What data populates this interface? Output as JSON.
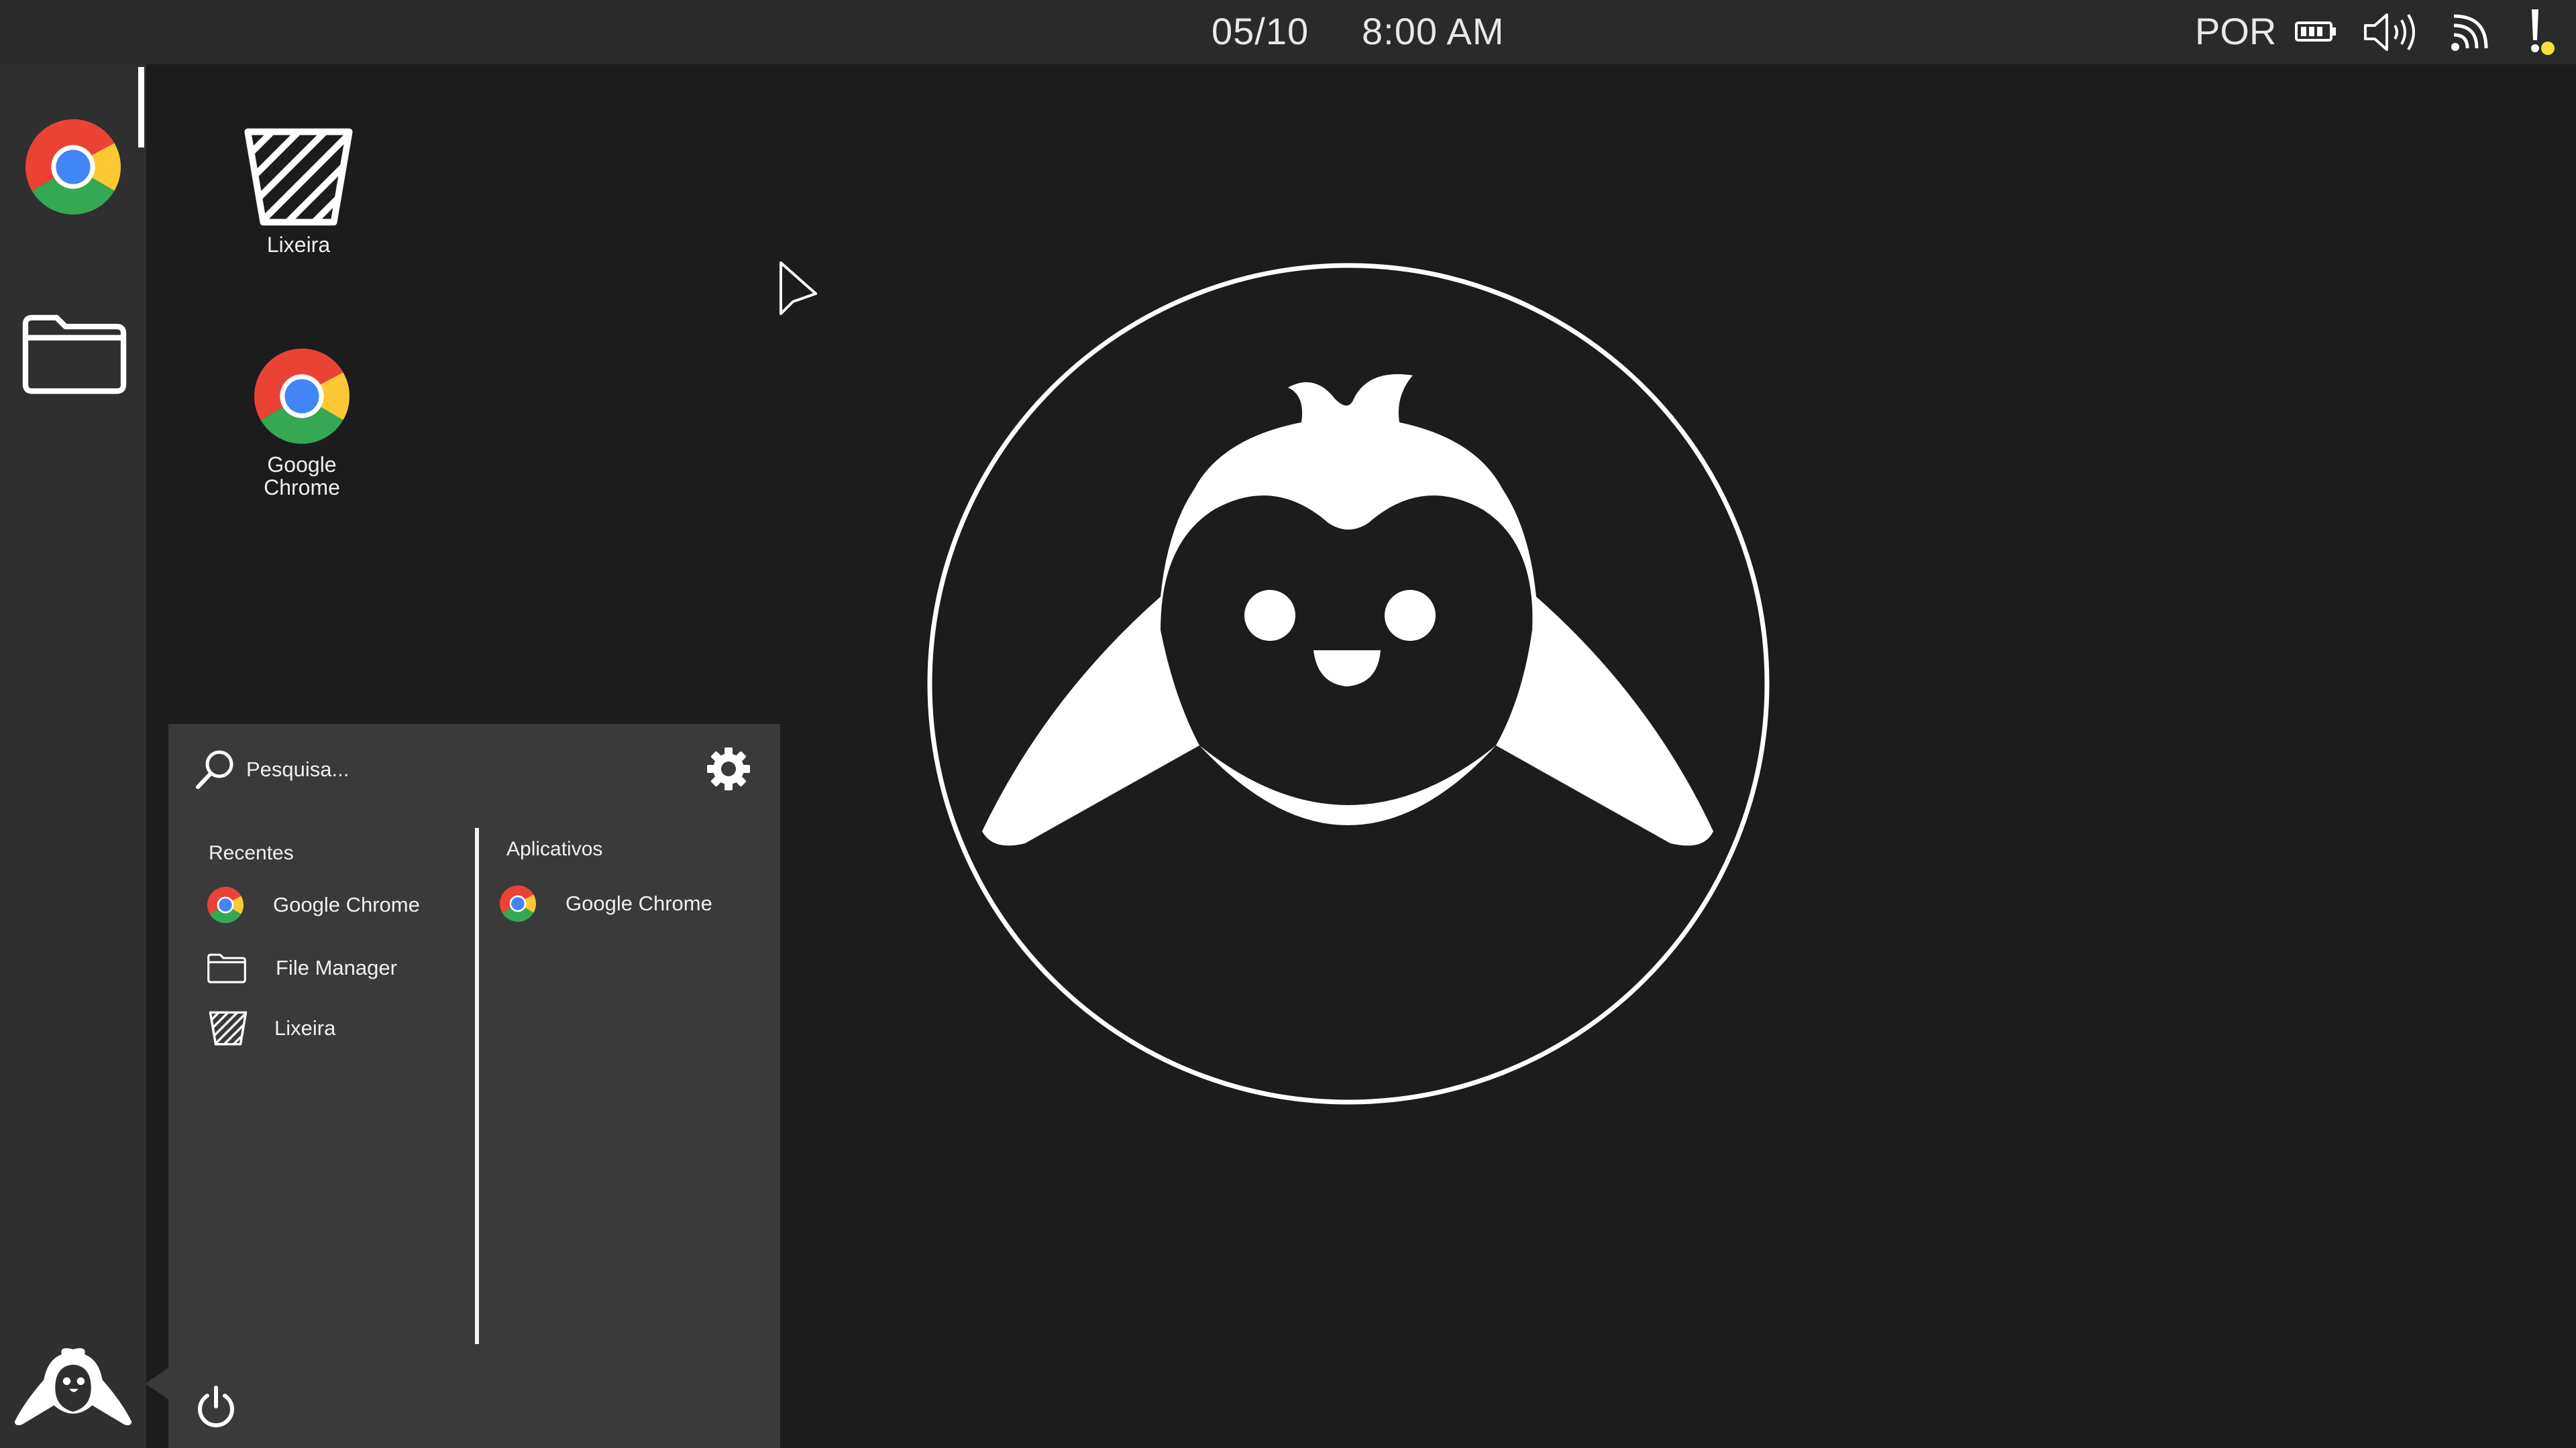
{
  "topbar": {
    "date": "05/10",
    "time": "8:00 AM",
    "language": "POR",
    "icons": [
      "battery-icon",
      "volume-icon",
      "wifi-icon",
      "notification-icon"
    ],
    "notification_dot_color": "#f5e23a"
  },
  "dock": {
    "items": [
      {
        "name": "Google Chrome",
        "icon": "chrome-icon",
        "active": true
      },
      {
        "name": "File Manager",
        "icon": "folder-icon",
        "active": false
      }
    ],
    "launcher_icon": "penguin-icon"
  },
  "desktop": {
    "icons": [
      {
        "label": "Lixeira",
        "icon": "trash-icon"
      },
      {
        "label": "Google Chrome",
        "icon": "chrome-icon"
      }
    ],
    "wallpaper": "penguin-logo-circle"
  },
  "launcher": {
    "search_placeholder": "Pesquisa...",
    "recent_title": "Recentes",
    "recent": [
      {
        "label": "Google Chrome",
        "icon": "chrome-icon"
      },
      {
        "label": "File Manager",
        "icon": "folder-icon"
      },
      {
        "label": "Lixeira",
        "icon": "trash-icon"
      }
    ],
    "apps_title": "Aplicativos",
    "apps": [
      {
        "label": "Google Chrome",
        "icon": "chrome-icon"
      }
    ]
  },
  "colors": {
    "desktop_bg": "#1c1c1c",
    "topbar_bg": "#2a2a2a",
    "dock_bg": "#2f2f2f",
    "launcher_bg": "#3a3a3a"
  }
}
